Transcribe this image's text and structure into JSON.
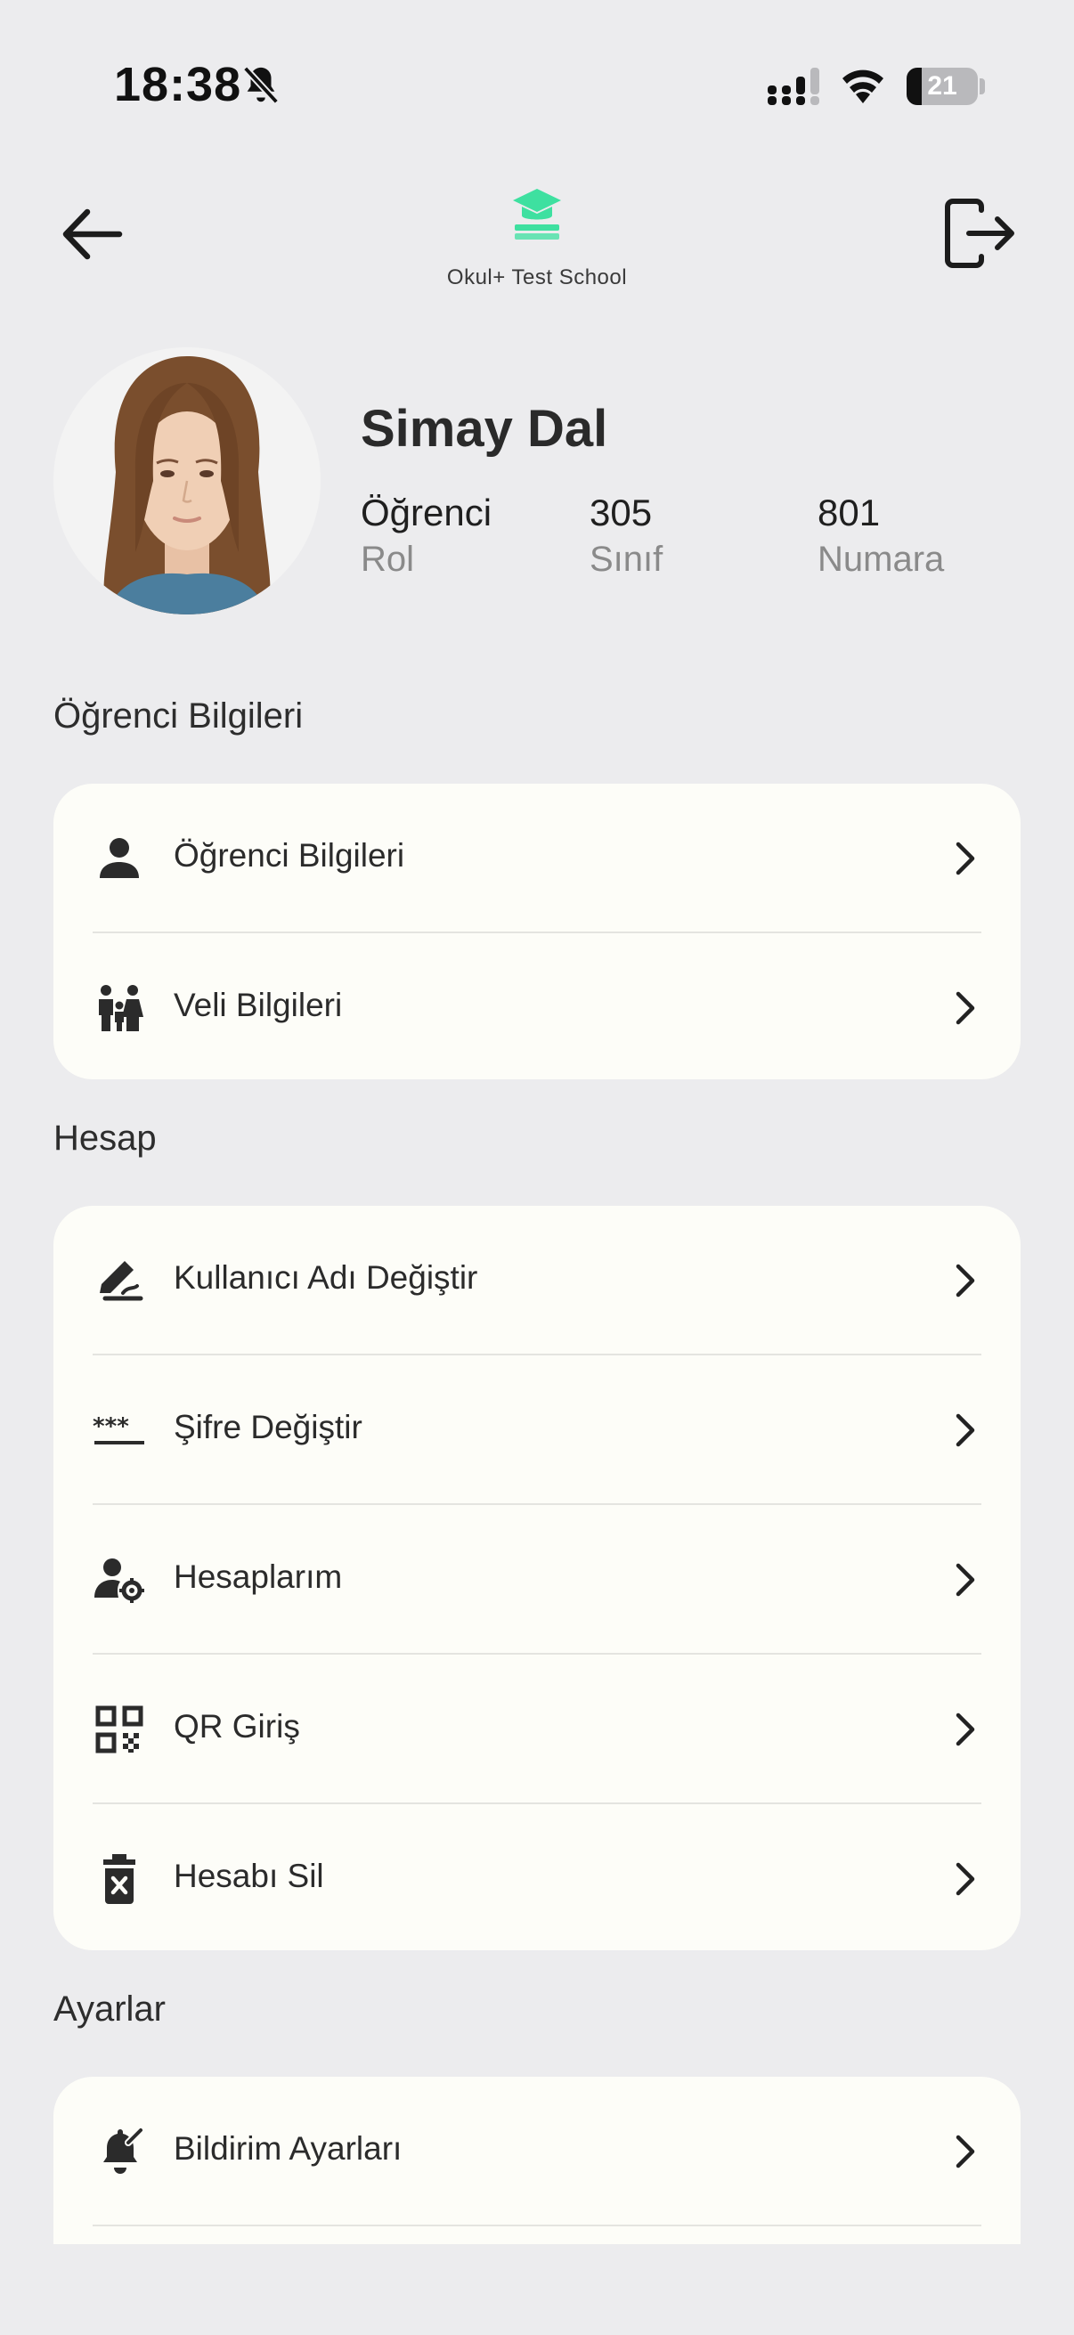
{
  "status_bar": {
    "time": "18:38",
    "battery_level": "21",
    "battery_fraction": 0.21,
    "icons": [
      "bell-slash-icon",
      "cellular-signal-icon",
      "wifi-icon",
      "battery-icon"
    ]
  },
  "header": {
    "school_name": "Okul+ Test School",
    "logo_color": "#3ee0a0",
    "back_icon": "arrow-left-icon",
    "logout_icon": "logout-icon"
  },
  "profile": {
    "name": "Simay Dal",
    "stats": [
      {
        "value": "Öğrenci",
        "label": "Rol"
      },
      {
        "value": "305",
        "label": "Sınıf"
      },
      {
        "value": "801",
        "label": "Numara"
      }
    ]
  },
  "sections": [
    {
      "title": "Öğrenci Bilgileri",
      "items": [
        {
          "label": "Öğrenci Bilgileri",
          "icon": "person-icon"
        },
        {
          "label": "Veli Bilgileri",
          "icon": "family-icon"
        }
      ]
    },
    {
      "title": "Hesap",
      "items": [
        {
          "label": "Kullanıcı Adı Değiştir",
          "icon": "edit-signature-icon"
        },
        {
          "label": "Şifre Değiştir",
          "icon": "password-icon"
        },
        {
          "label": "Hesaplarım",
          "icon": "manage-accounts-icon"
        },
        {
          "label": "QR Giriş",
          "icon": "qr-code-icon"
        },
        {
          "label": "Hesabı Sil",
          "icon": "delete-icon"
        }
      ]
    },
    {
      "title": "Ayarlar",
      "items": [
        {
          "label": "Bildirim Ayarları",
          "icon": "notification-edit-icon"
        }
      ]
    }
  ]
}
